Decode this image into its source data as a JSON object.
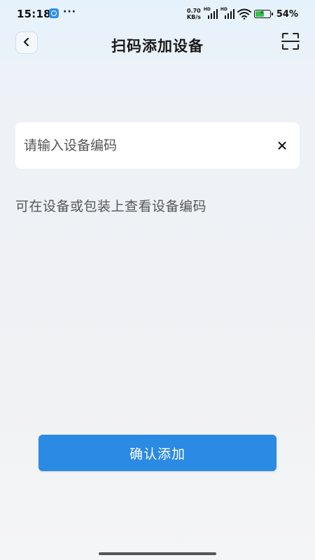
{
  "status_bar": {
    "time": "15:18",
    "dots": "···",
    "net_speed_value": "0.70",
    "net_speed_unit": "KB/s",
    "hd1": "HD",
    "hd2": "HD",
    "battery_percent": "54%"
  },
  "header": {
    "title": "扫码添加设备",
    "back_icon": "chevron-left-icon",
    "scan_icon": "scan-frame-icon"
  },
  "form": {
    "input_value": "",
    "input_placeholder": "请输入设备编码",
    "clear_icon": "close-icon",
    "hint": "可在设备或包装上查看设备编码"
  },
  "actions": {
    "confirm_label": "确认添加"
  },
  "colors": {
    "primary": "#2b8ae4",
    "battery_fill": "#35c24a"
  }
}
